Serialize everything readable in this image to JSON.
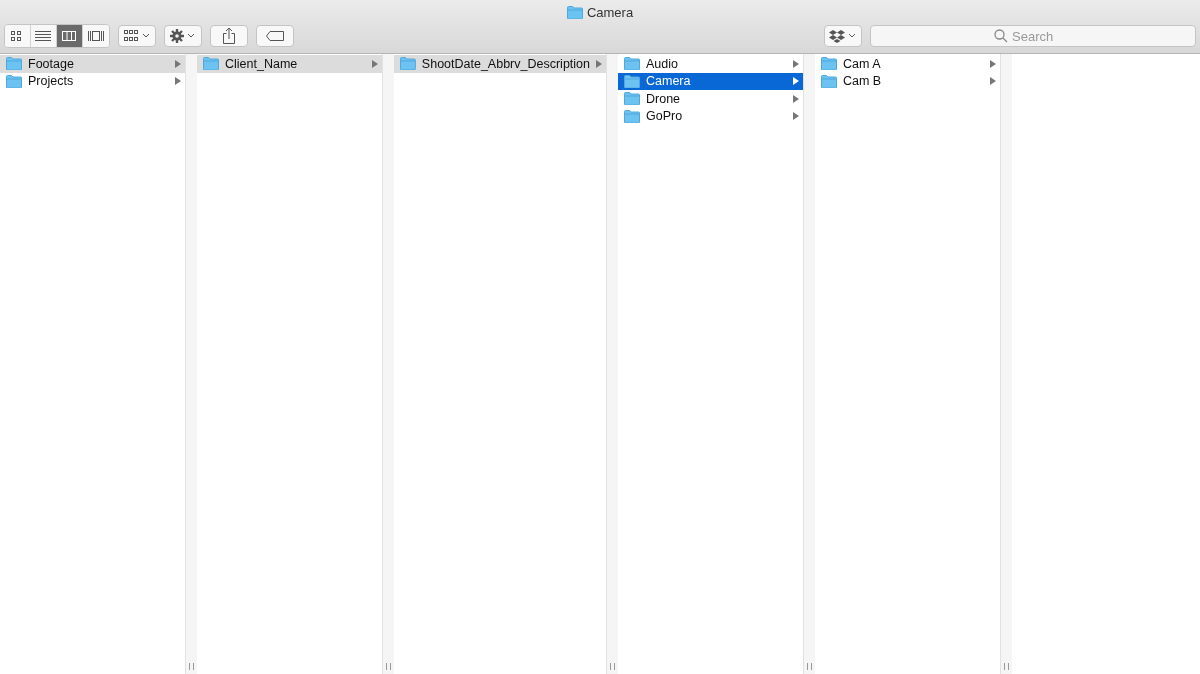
{
  "window": {
    "title": "Camera"
  },
  "toolbar": {
    "view_modes": [
      {
        "kind": "icons",
        "selected": false
      },
      {
        "kind": "list",
        "selected": false
      },
      {
        "kind": "columns",
        "selected": true
      },
      {
        "kind": "gallery",
        "selected": false
      }
    ],
    "search": {
      "placeholder": "Search"
    }
  },
  "columns": [
    {
      "active": false,
      "items": [
        {
          "name": "Footage",
          "selected": true
        },
        {
          "name": "Projects",
          "selected": false
        }
      ]
    },
    {
      "active": false,
      "items": [
        {
          "name": "Client_Name",
          "selected": true
        }
      ]
    },
    {
      "active": false,
      "items": [
        {
          "name": "ShootDate_Abbrv_Description",
          "selected": true
        }
      ]
    },
    {
      "active": true,
      "items": [
        {
          "name": "Audio",
          "selected": false
        },
        {
          "name": "Camera",
          "selected": true
        },
        {
          "name": "Drone",
          "selected": false
        },
        {
          "name": "GoPro",
          "selected": false
        }
      ]
    },
    {
      "items": [
        {
          "name": "Cam A",
          "selected": false
        },
        {
          "name": "Cam B",
          "selected": false
        }
      ]
    }
  ]
}
